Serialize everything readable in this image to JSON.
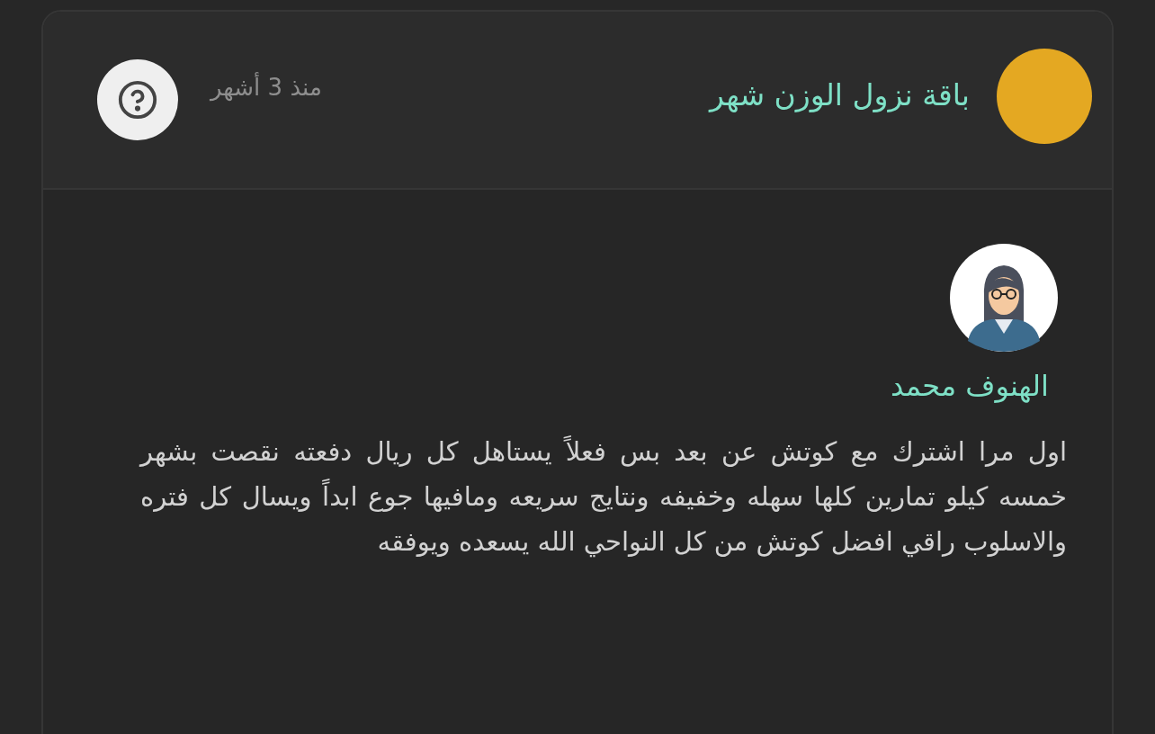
{
  "product": {
    "title": "باقة نزول الوزن شهر",
    "time": "منذ 3 أشهر"
  },
  "review": {
    "author": "الهنوف محمد",
    "text": "اول مرا اشترك مع كوتش عن بعد بس فعلاً يستاهل كل ريال دفعته نقصت بشهر خمسه كيلو تمارين كلها سهله وخفيفه ونتايج سريعه ومافيها جوع ابداً ويسال كل فتره والاسلوب راقي افضل كوتش من كل النواحي الله يسعده ويوفقه"
  }
}
